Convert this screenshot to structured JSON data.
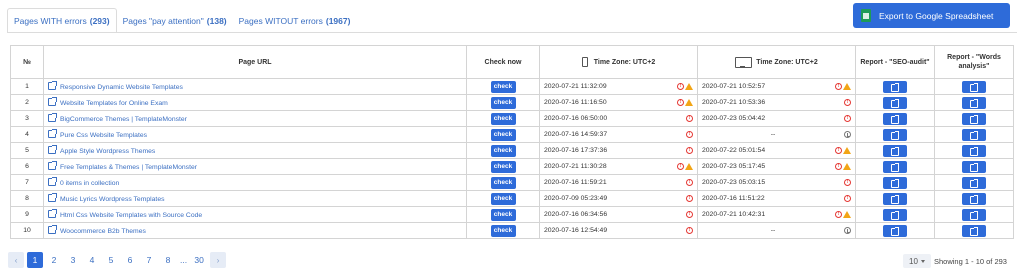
{
  "tabs": [
    {
      "label": "Pages WITH errors",
      "count": "(293)"
    },
    {
      "label": "Pages \"pay attention\"",
      "count": "(138)"
    },
    {
      "label": "Pages WITOUT errors",
      "count": "(1967)"
    }
  ],
  "export_label": "Export to Google Spreadsheet",
  "table": {
    "headers": {
      "num": "№",
      "url": "Page URL",
      "check": "Check now",
      "tz_mobile": "Time Zone: UTC+2",
      "tz_desktop": "Time Zone: UTC+2",
      "report_seo": "Report - \"SEO-audit\"",
      "report_words": "Report - \"Words analysis\""
    },
    "check_label": "check",
    "rows": [
      {
        "num": "1",
        "url": "Responsive Dynamic Website Templates",
        "mobile": "2020-07-21 11:32:09",
        "m_status": "error-warning",
        "desktop": "2020-07-21 10:52:57",
        "d_status": "error-warning"
      },
      {
        "num": "2",
        "url": "Website Templates for Online Exam",
        "mobile": "2020-07-16 11:16:50",
        "m_status": "error-warning",
        "desktop": "2020-07-21 10:53:36",
        "d_status": "error"
      },
      {
        "num": "3",
        "url": "BigCommerce Themes | TemplateMonster",
        "mobile": "2020-07-16 06:50:00",
        "m_status": "error",
        "desktop": "2020-07-23 05:04:42",
        "d_status": "error"
      },
      {
        "num": "4",
        "url": "Pure Css Website Templates",
        "mobile": "2020-07-16 14:59:37",
        "m_status": "error",
        "desktop": "--",
        "d_status": "pending"
      },
      {
        "num": "5",
        "url": "Apple Style Wordpress Themes",
        "mobile": "2020-07-16 17:37:36",
        "m_status": "error",
        "desktop": "2020-07-22 05:01:54",
        "d_status": "error-warning"
      },
      {
        "num": "6",
        "url": "Free Templates & Themes | TemplateMonster",
        "mobile": "2020-07-21 11:30:28",
        "m_status": "error-warning",
        "desktop": "2020-07-23 05:17:45",
        "d_status": "error-warning"
      },
      {
        "num": "7",
        "url": "0 items in collection",
        "mobile": "2020-07-16 11:59:21",
        "m_status": "error",
        "desktop": "2020-07-23 05:03:15",
        "d_status": "error"
      },
      {
        "num": "8",
        "url": "Music Lyrics Wordpress Templates",
        "mobile": "2020-07-09 05:23:49",
        "m_status": "error",
        "desktop": "2020-07-16 11:51:22",
        "d_status": "error"
      },
      {
        "num": "9",
        "url": "Html Css Website Templates with Source Code",
        "mobile": "2020-07-16 06:34:56",
        "m_status": "error",
        "desktop": "2020-07-21 10:42:31",
        "d_status": "error-warning"
      },
      {
        "num": "10",
        "url": "Woocommerce B2b Themes",
        "mobile": "2020-07-16 12:54:49",
        "m_status": "error",
        "desktop": "--",
        "d_status": "pending"
      }
    ]
  },
  "pagination": {
    "prev": "‹",
    "next": "›",
    "pages": [
      "1",
      "2",
      "3",
      "4",
      "5",
      "6",
      "7",
      "8"
    ],
    "ellipsis": "...",
    "last": "30",
    "page_size": "10",
    "showing": "Showing 1 - 10 of 293"
  },
  "colors": {
    "accent": "#2e6bd9",
    "link": "#3b6fc2",
    "error": "#e53935",
    "warning": "#f2a516"
  }
}
